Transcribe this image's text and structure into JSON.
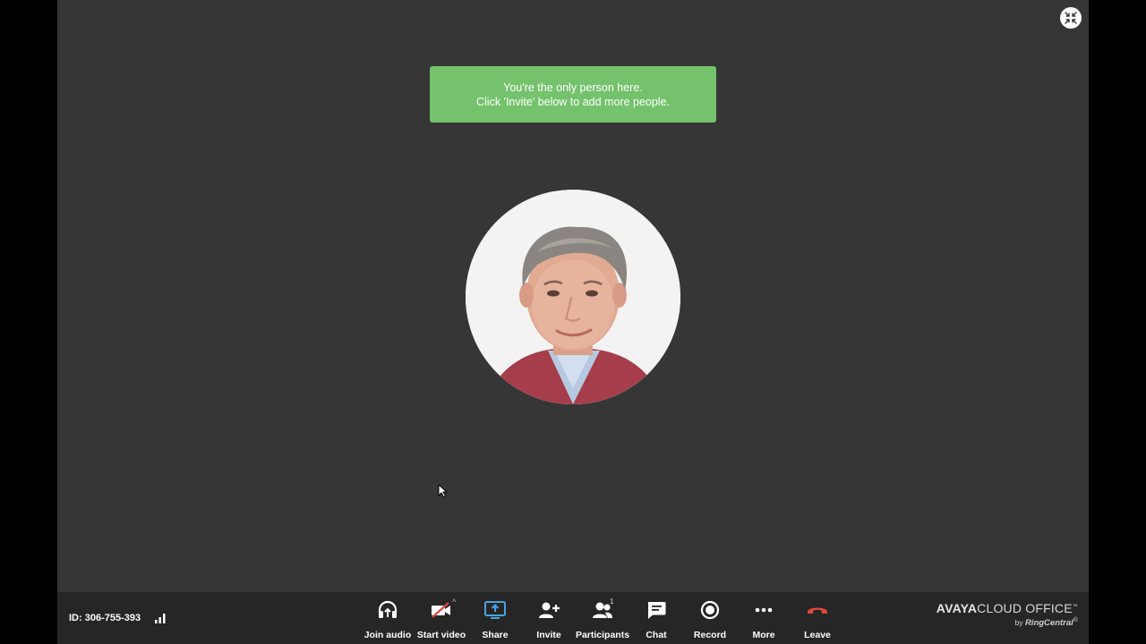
{
  "notice": {
    "line1": "You're the only person here.",
    "line2": "Click 'Invite' below to add more people."
  },
  "meeting": {
    "id_label": "ID: 306-755-393"
  },
  "toolbar": {
    "items": [
      {
        "label": "Join audio",
        "icon": "headphones-icon"
      },
      {
        "label": "Start video",
        "icon": "video-off-icon"
      },
      {
        "label": "Share",
        "icon": "share-screen-icon"
      },
      {
        "label": "Invite",
        "icon": "add-person-icon"
      },
      {
        "label": "Participants",
        "icon": "participants-icon",
        "count": "1"
      },
      {
        "label": "Chat",
        "icon": "chat-icon"
      },
      {
        "label": "Record",
        "icon": "record-icon"
      },
      {
        "label": "More",
        "icon": "more-icon"
      },
      {
        "label": "Leave",
        "icon": "hang-up-icon"
      }
    ],
    "video_caret": "^"
  },
  "brand": {
    "avaya": "AVAYA",
    "product": "CLOUD OFFICE",
    "tm": "™",
    "by": "by",
    "partner": "RingCentral",
    "partner_mark": "®"
  },
  "colors": {
    "stage_bg": "#363636",
    "toolbar_bg": "#262626",
    "notice_bg": "#74c26c",
    "share_accent": "#4aa3e0",
    "leave_red": "#e0463c"
  }
}
